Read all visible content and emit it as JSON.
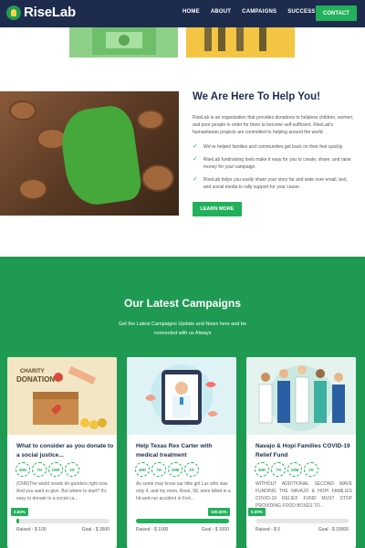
{
  "nav": {
    "brand": "RiseLab",
    "items": [
      "HOME",
      "ABOUT",
      "CAMPAIGNS",
      "SUCCESS STORY"
    ],
    "contact": "CONTACT"
  },
  "help": {
    "title": "We Are Here To Help You!",
    "desc": "RiseLab is an organization that provides donations to helpless children, women, and poor people in order for them to become self-sufficient. RiseLab's humanitarian projects are committed to helping around the world.",
    "checks": [
      "We've helped families and communities get back on their feet quickly.",
      "RiseLab fundraising tools make it easy for you to create, share, and raise money for your campaign.",
      "RiseLab helps you easily share your story far and wide over email, text, and social media to rally support for your cause."
    ],
    "learn_more": "LEARN MORE"
  },
  "campaigns": {
    "title": "Our Latest Campaigns",
    "subtitle": "Get the Latest Campaigns Update and News here and be connected with us Always",
    "timers": [
      "46D",
      "7H",
      "19M",
      "2S"
    ],
    "cards": [
      {
        "title": "What to consider as you donate to a social justice...",
        "desc": "(CNN)The world needs do-gooders right now. And you want to give. But where to start? It's easy to donate to a social ca...",
        "percent_label": "2.84%",
        "progress": 0.0284,
        "raised": "Raised - $ 100",
        "goal": "Goal - $ 3500",
        "image_label": "DONATION",
        "image_label2": "CHARITY"
      },
      {
        "title": "Help Texas Rex Carter with medical treatment",
        "desc": "As some may know our little girl Lux who was only 4, and my mom, Rose, 58, were killed in a hit-and-run accident in Fort...",
        "percent_label": "100.00%",
        "progress": 1.0,
        "raised": "Raised - $ 1000",
        "goal": "Goal - $ 1000"
      },
      {
        "title": "Navajo & Hopi Families COVID-19 Relief Fund",
        "desc": "WITHOUT ADDITIONAL SECOND WAVE FUNDING THE NAVAJO & HOPI FAMILIES COVID-19 RELIEF FUND MUST STOP PROVIDING FOOD BOXES TO...",
        "percent_label": "0.00%",
        "progress": 0,
        "raised": "Raised - $ 0",
        "goal": "Goal - $ 10000"
      }
    ]
  },
  "colors": {
    "nav": "#1d2b4d",
    "accent": "#22b05b",
    "section": "#1f9a52"
  }
}
